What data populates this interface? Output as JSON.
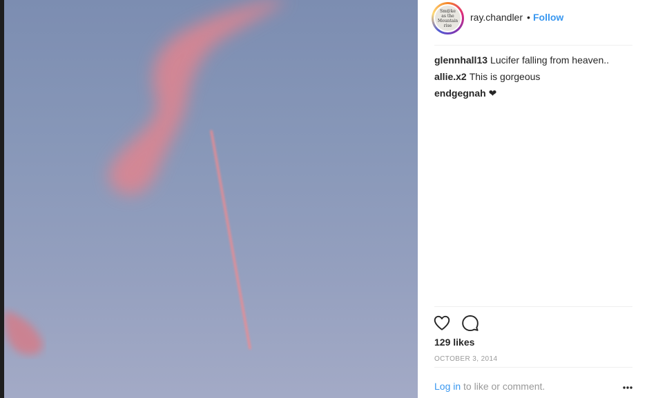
{
  "post": {
    "username": "ray.chandler",
    "separator": "•",
    "follow_label": "Follow",
    "avatar_text": [
      "Sm@ke",
      "as the",
      "Mountain",
      "rise"
    ],
    "comments": [
      {
        "user": "glennhall13",
        "text": "Lucifer falling from heaven.."
      },
      {
        "user": "allie.x2",
        "text": "This is gorgeous"
      },
      {
        "user": "endgegnah",
        "text": "❤"
      }
    ],
    "likes": "129 likes",
    "date": "OCTOBER 3, 2014",
    "login_label": "Log in",
    "login_suffix": " to like or comment.",
    "icons": {
      "like": "heart-icon",
      "comment": "comment-icon",
      "more": "more-options-icon"
    }
  },
  "colors": {
    "link": "#3897f0",
    "text": "#262626",
    "muted": "#999999"
  }
}
